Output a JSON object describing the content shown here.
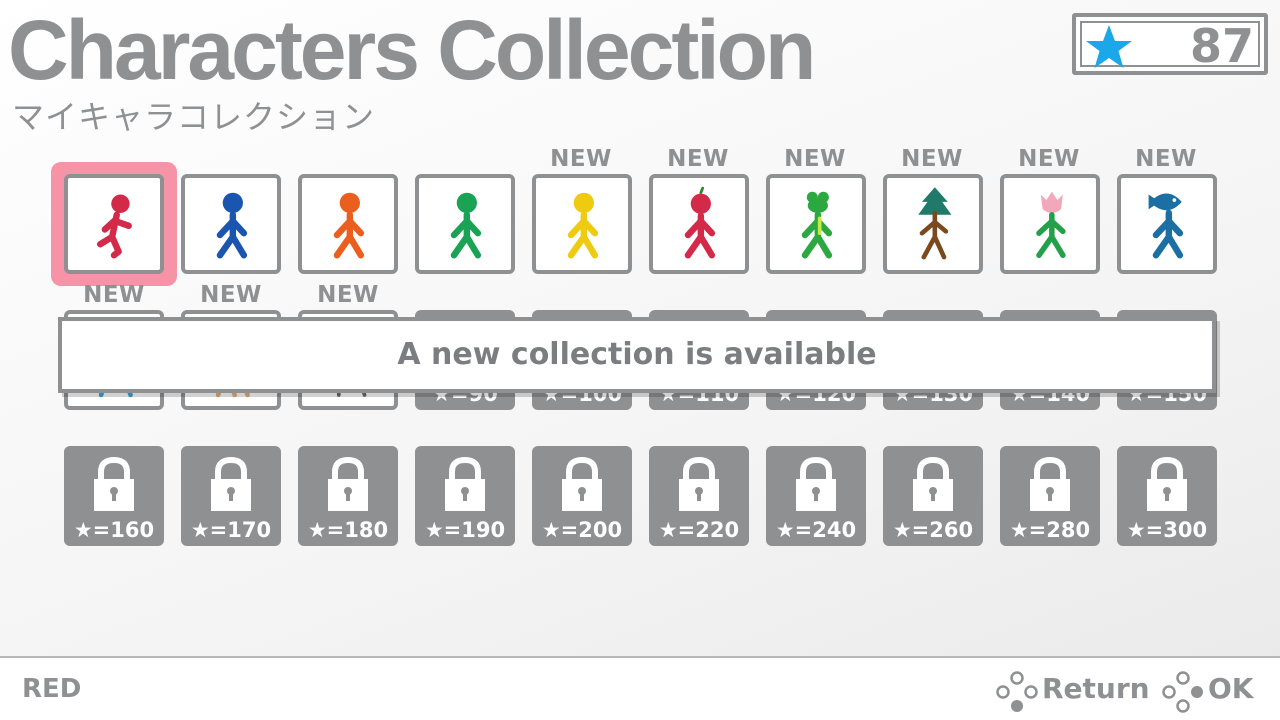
{
  "header": {
    "title": "Characters Collection",
    "subtitle": "マイキャラコレクション",
    "star_count": "87"
  },
  "colors": {
    "ui_gray": "#8e9092",
    "selection_pink": "#f793a6",
    "star_blue": "#1aa8e8"
  },
  "row1": [
    {
      "id": "red",
      "color": "#d42a4a",
      "new": "",
      "selected": true
    },
    {
      "id": "blue",
      "color": "#1a56b0",
      "new": ""
    },
    {
      "id": "orange",
      "color": "#ea5e1e",
      "new": ""
    },
    {
      "id": "green",
      "color": "#1aa255",
      "new": ""
    },
    {
      "id": "yellow",
      "color": "#eecb10",
      "new": "NEW"
    },
    {
      "id": "apple",
      "color": "#d42a4a",
      "new": "NEW"
    },
    {
      "id": "frog",
      "color": "#2ca841",
      "new": "NEW"
    },
    {
      "id": "tree",
      "color": "#7a4a1e",
      "new": "NEW"
    },
    {
      "id": "tulip",
      "color": "#25a04a",
      "new": "NEW"
    },
    {
      "id": "fish",
      "color": "#1b6fa2",
      "new": "NEW"
    }
  ],
  "row2": {
    "new_labels": [
      "NEW",
      "NEW",
      "NEW",
      "",
      "",
      "",
      "",
      "",
      "",
      ""
    ],
    "partial_costs": [
      "",
      "",
      "",
      "★=90",
      "★=100",
      "★=110",
      "★=120",
      "★=130",
      "★=140",
      "★=150"
    ]
  },
  "row3_costs": [
    "★=160",
    "★=170",
    "★=180",
    "★=190",
    "★=200",
    "★=220",
    "★=240",
    "★=260",
    "★=280",
    "★=300"
  ],
  "banner": "A new collection is available",
  "footer": {
    "selected_name": "RED",
    "return_label": "Return",
    "ok_label": "OK"
  }
}
